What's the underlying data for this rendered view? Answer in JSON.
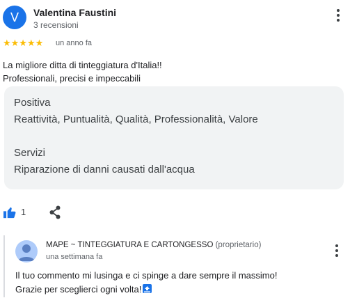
{
  "reviewer": {
    "avatar_initial": "V",
    "name": "Valentina Faustini",
    "review_count": "3 recensioni"
  },
  "rating": {
    "stars": "★★★★★",
    "value": 5,
    "max": 5,
    "time": "un anno fa"
  },
  "review": {
    "line1": "La migliore ditta di tinteggiatura d'Italia!!",
    "line2": "Professionali, precisi e impeccabili"
  },
  "attributes": {
    "positive_label": "Positiva",
    "positive_value": "Reattività, Puntualità, Qualità, Professionalità, Valore",
    "services_label": "Servizi",
    "services_value": "Riparazione di danni causati dall'acqua"
  },
  "actions": {
    "like_count": "1"
  },
  "owner_reply": {
    "name": "MAPE ~ TINTEGGIATURA E CARTONGESSO",
    "role": "(proprietario)",
    "time": "una settimana fa",
    "line1": "Il tuo commento mi lusinga e ci spinge a dare sempre il massimo!",
    "line2": "Grazie per sceglierci ogni volta!"
  },
  "icons": {
    "like": "thumbs-up-icon",
    "share": "share-icon",
    "more": "more-vert-icon",
    "top_emoji": "top-arrow-emoji"
  },
  "colors": {
    "accent": "#1a73e8",
    "star": "#fbbc04",
    "panel": "#f1f3f4"
  }
}
